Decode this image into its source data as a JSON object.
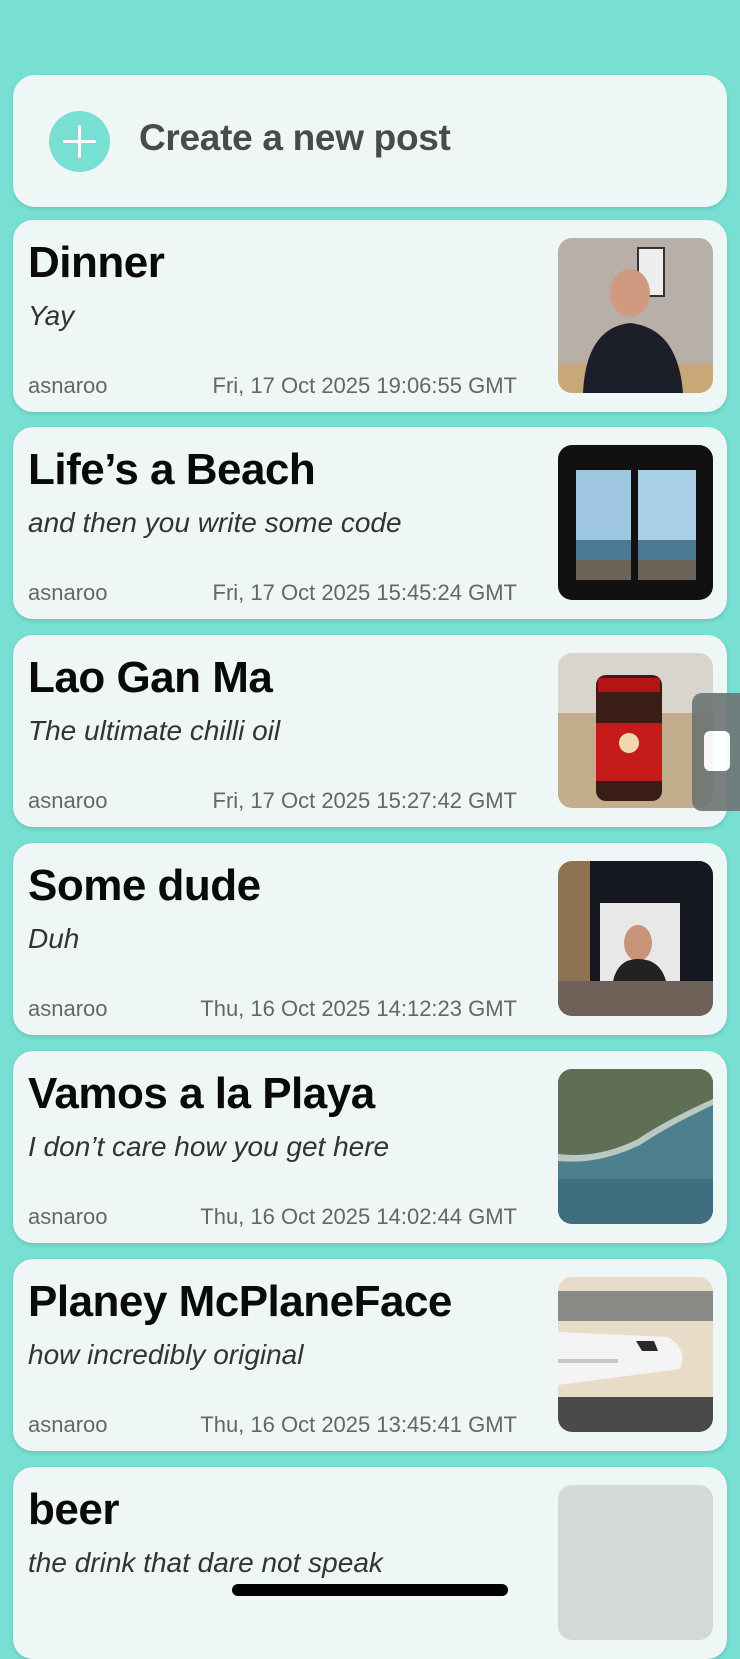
{
  "create": {
    "label": "Create a new post",
    "icon": "plus-icon"
  },
  "posts": [
    {
      "title": "Dinner",
      "subtitle": "Yay",
      "author": "asnaroo",
      "date": "Fri, 17 Oct 2025 19:06:55 GMT",
      "thumb": "man-portrait"
    },
    {
      "title": "Life’s a Beach",
      "subtitle": "and then you write some code",
      "author": "asnaroo",
      "date": "Fri, 17 Oct 2025 15:45:24 GMT",
      "thumb": "beach-window"
    },
    {
      "title": "Lao Gan Ma",
      "subtitle": "The ultimate chilli oil",
      "author": "asnaroo",
      "date": "Fri, 17 Oct 2025 15:27:42 GMT",
      "thumb": "chilli-jar"
    },
    {
      "title": "Some dude",
      "subtitle": "Duh",
      "author": "asnaroo",
      "date": "Thu, 16 Oct 2025 14:12:23 GMT",
      "thumb": "laptop-selfie"
    },
    {
      "title": "Vamos a la Playa",
      "subtitle": "I don’t care how you get here",
      "author": "asnaroo",
      "date": "Thu, 16 Oct 2025 14:02:44 GMT",
      "thumb": "aerial-coast"
    },
    {
      "title": "Planey McPlaneFace",
      "subtitle": "how incredibly original",
      "author": "asnaroo",
      "date": "Thu, 16 Oct 2025 13:45:41 GMT",
      "thumb": "airplane"
    },
    {
      "title": "beer",
      "subtitle": "the drink that dare not speak",
      "author": "",
      "date": "",
      "thumb": "placeholder"
    }
  ]
}
